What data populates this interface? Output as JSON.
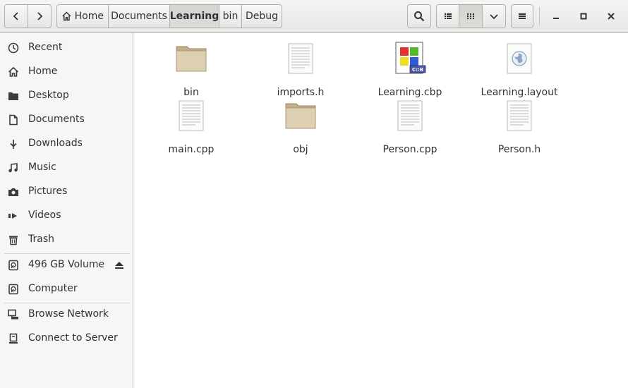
{
  "toolbar": {
    "back_icon": "chevron-left-icon",
    "forward_icon": "chevron-right-icon",
    "breadcrumbs": [
      {
        "label": "Home",
        "icon": "home-icon",
        "active": false
      },
      {
        "label": "Documents",
        "active": false
      },
      {
        "label": "Learning",
        "active": true
      },
      {
        "label": "bin",
        "active": false
      },
      {
        "label": "Debug",
        "active": false
      }
    ],
    "search_icon": "search-icon",
    "list_view_icon": "list-view-icon",
    "grid_view_icon": "grid-view-icon",
    "view_options_icon": "chevron-down-icon",
    "menu_icon": "hamburger-menu-icon",
    "minimize_icon": "minimize-icon",
    "maximize_icon": "maximize-icon",
    "close_icon": "close-icon"
  },
  "sidebar": {
    "items": [
      {
        "label": "Recent",
        "icon": "clock-icon"
      },
      {
        "label": "Home",
        "icon": "home-icon"
      },
      {
        "label": "Desktop",
        "icon": "folder-icon"
      },
      {
        "label": "Documents",
        "icon": "document-icon"
      },
      {
        "label": "Downloads",
        "icon": "download-icon"
      },
      {
        "label": "Music",
        "icon": "music-icon"
      },
      {
        "label": "Pictures",
        "icon": "camera-icon"
      },
      {
        "label": "Videos",
        "icon": "video-icon"
      },
      {
        "label": "Trash",
        "icon": "trash-icon"
      },
      {
        "label": "496 GB Volume",
        "icon": "drive-icon",
        "eject_icon": "eject-icon"
      },
      {
        "label": "Computer",
        "icon": "computer-icon"
      },
      {
        "label": "Browse Network",
        "icon": "network-icon"
      },
      {
        "label": "Connect to Server",
        "icon": "server-icon"
      }
    ]
  },
  "files": [
    {
      "name": "bin",
      "type": "folder"
    },
    {
      "name": "imports.h",
      "type": "text"
    },
    {
      "name": "Learning.cbp",
      "type": "codeblocks-project"
    },
    {
      "name": "Learning.layout",
      "type": "web"
    },
    {
      "name": "main.cpp",
      "type": "text"
    },
    {
      "name": "obj",
      "type": "folder"
    },
    {
      "name": "Person.cpp",
      "type": "text"
    },
    {
      "name": "Person.h",
      "type": "text"
    }
  ],
  "colors": {
    "folder": "#d8c9a8",
    "folder_tab": "#c2ae89",
    "accent_red": "#e8312f",
    "accent_green": "#53b82a",
    "accent_blue": "#2e5bd0",
    "accent_yellow": "#f1dd1f"
  }
}
